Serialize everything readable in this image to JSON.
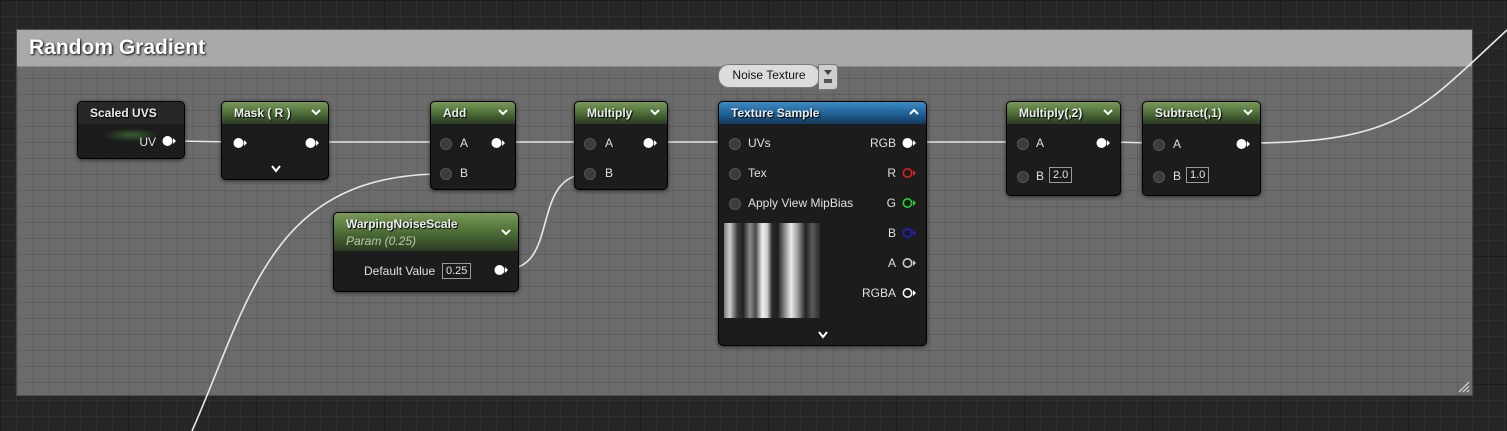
{
  "comment": {
    "title": "Random Gradient"
  },
  "texture_tag": {
    "label": "Noise Texture"
  },
  "nodes": {
    "scaled_uvs": {
      "title": "Scaled UVS",
      "out_label": "UV"
    },
    "mask": {
      "title": "Mask ( R )"
    },
    "add": {
      "title": "Add",
      "pin_a": "A",
      "pin_b": "B"
    },
    "warping": {
      "title": "WarpingNoiseScale",
      "subtitle": "Param (0.25)",
      "default_label": "Default Value",
      "default_value": "0.25"
    },
    "multiply": {
      "title": "Multiply",
      "pin_a": "A",
      "pin_b": "B"
    },
    "texture_sample": {
      "title": "Texture Sample",
      "inputs": [
        "UVs",
        "Tex",
        "Apply View MipBias"
      ],
      "outputs": [
        "RGB",
        "R",
        "G",
        "B",
        "A",
        "RGBA"
      ]
    },
    "multiply2": {
      "title": "Multiply(,2)",
      "pin_a": "A",
      "pin_b": "B",
      "b_value": "2.0"
    },
    "subtract": {
      "title": "Subtract(,1)",
      "pin_a": "A",
      "pin_b": "B",
      "b_value": "1.0"
    }
  },
  "colors": {
    "pin_r": "#e02020",
    "pin_g": "#2ad12a",
    "pin_b": "#2020c8",
    "pin_a": "#cfcfcf",
    "wire": "#e8e8e8",
    "material_header": "#4d6e37",
    "texture_header": "#1f5f93"
  }
}
